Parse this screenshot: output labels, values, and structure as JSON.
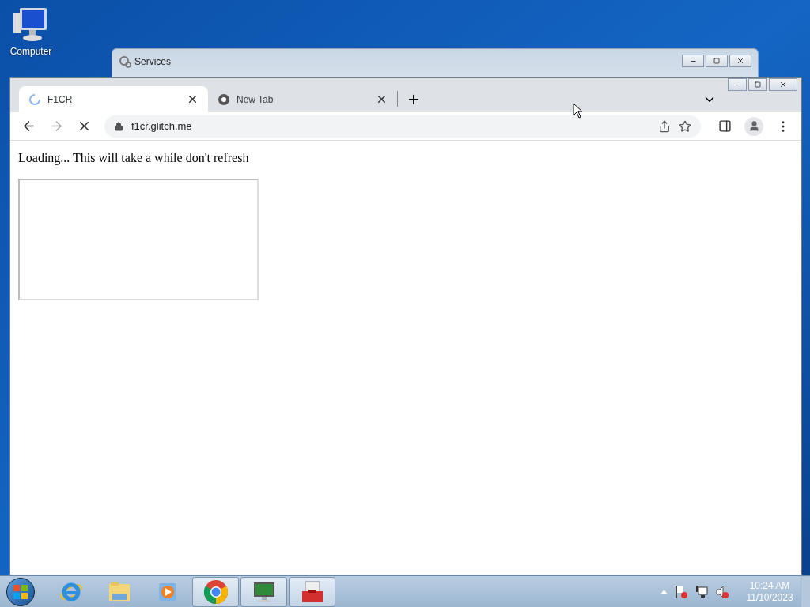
{
  "desktop": {
    "icons": [
      {
        "label": "Computer"
      }
    ]
  },
  "background_window": {
    "title": "Services"
  },
  "browser": {
    "tabs": [
      {
        "title": "F1CR",
        "selected": true,
        "loading": true
      },
      {
        "title": "New Tab",
        "selected": false,
        "loading": false
      }
    ],
    "address": "f1cr.glitch.me",
    "loading": true,
    "page": {
      "text": "Loading... This will take a while don't refresh"
    }
  },
  "taskbar": {
    "apps": [
      {
        "kind": "ie",
        "selected": false
      },
      {
        "kind": "explorer",
        "selected": false
      },
      {
        "kind": "media",
        "selected": false
      },
      {
        "kind": "chrome",
        "selected": true
      },
      {
        "kind": "monitor",
        "selected": true
      },
      {
        "kind": "toolbox",
        "selected": true
      }
    ],
    "clock": {
      "time": "10:24 AM",
      "date": "11/10/2023"
    }
  }
}
